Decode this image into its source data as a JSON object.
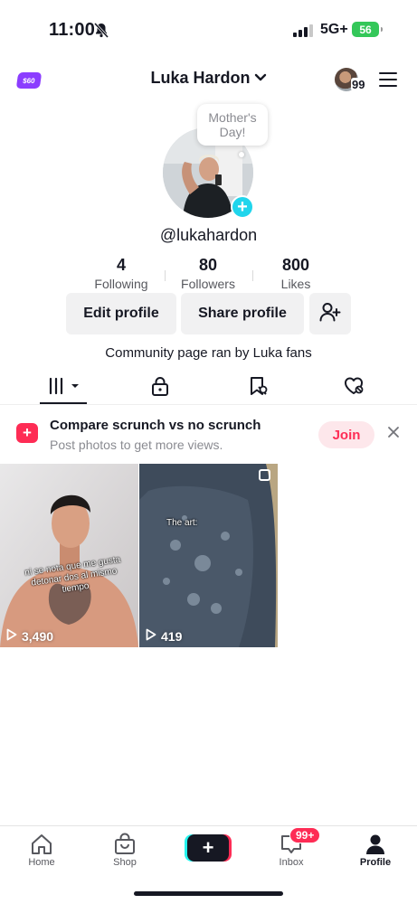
{
  "status_bar": {
    "time": "11:00",
    "network": "5G+",
    "battery": "56"
  },
  "header": {
    "coin_badge": "$60",
    "username_title": "Luka Hardon",
    "notification_count": "99"
  },
  "profile": {
    "bubble_note": "Mother's Day!",
    "handle": "@lukahardon",
    "stats": [
      {
        "value": "4",
        "label": "Following"
      },
      {
        "value": "80",
        "label": "Followers"
      },
      {
        "value": "800",
        "label": "Likes"
      }
    ],
    "edit_button": "Edit profile",
    "share_button": "Share profile",
    "bio": "Community page ran by Luka fans"
  },
  "tabs": [
    "videos-grid-icon",
    "lock-icon",
    "tagged-icon",
    "liked-icon"
  ],
  "promo": {
    "title": "Compare scrunch vs no scrunch",
    "subtitle": "Post photos to get more views.",
    "join_label": "Join"
  },
  "videos": [
    {
      "views": "3,490",
      "caption": "ni se nota que me gusta detonar dos al mismo tiempo"
    },
    {
      "views": "419",
      "caption": "The art:"
    }
  ],
  "bottom_nav": [
    {
      "label": "Home"
    },
    {
      "label": "Shop"
    },
    {
      "label": ""
    },
    {
      "label": "Inbox",
      "badge": "99+"
    },
    {
      "label": "Profile"
    }
  ],
  "colors": {
    "accent": "#fe2c55",
    "cyan": "#20d5ec",
    "text": "#161823"
  }
}
